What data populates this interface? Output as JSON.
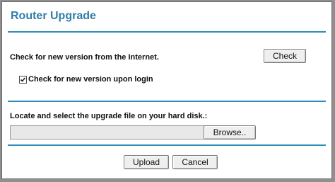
{
  "page": {
    "title": "Router Upgrade"
  },
  "check_section": {
    "description": "Check for new version from the Internet.",
    "check_button_label": "Check",
    "login_check": {
      "label": "Check for new version upon login",
      "checked": true
    }
  },
  "upload_section": {
    "description": "Locate and select the upgrade file on your hard disk.:",
    "file_value": "",
    "browse_button_label": "Browse.."
  },
  "actions": {
    "upload_label": "Upload",
    "cancel_label": "Cancel"
  },
  "colors": {
    "title": "#2f7ea9",
    "divider": "#2f8fb7",
    "frame": "#8f8f8f"
  }
}
